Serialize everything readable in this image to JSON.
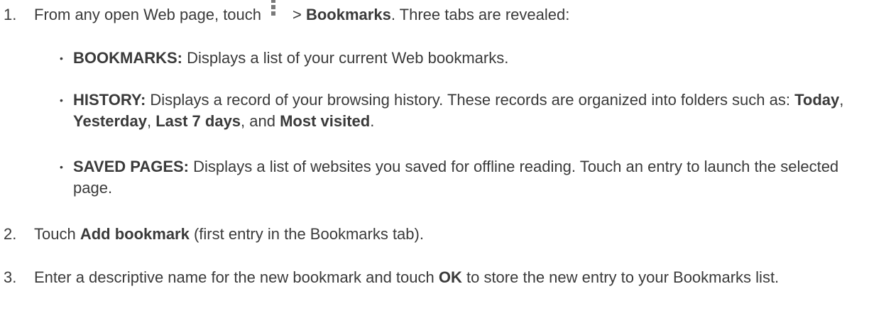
{
  "steps": [
    {
      "number": "1.",
      "before_icon": "From any open Web page, touch",
      "icon": "menu-overflow-icon",
      "after_icon_prefix": "> ",
      "bold": "Bookmarks",
      "after_bold": ". Three tabs are revealed:"
    },
    {
      "number": "2.",
      "prefix": "Touch ",
      "bold": "Add bookmark",
      "suffix": " (first entry in the Bookmarks tab)."
    },
    {
      "number": "3.",
      "prefix": "Enter a descriptive name for the new bookmark and touch ",
      "bold": "OK",
      "suffix": " to store the new entry to your Bookmarks list."
    }
  ],
  "bullets": [
    {
      "symbol": "•",
      "label": "BOOKMARKS:",
      "text": " Displays a list of your current Web bookmarks."
    },
    {
      "symbol": "•",
      "label": "HISTORY:",
      "text": " Displays a record of your browsing history. These records are organized into folders such as: ",
      "folders": [
        "Today",
        "Yesterday",
        "Last 7 days",
        "Most visited"
      ],
      "separators": [
        ", ",
        ", ",
        ", and "
      ],
      "end": "."
    },
    {
      "symbol": "•",
      "label": "SAVED PAGES:",
      "text": " Displays a list of websites you saved for offline reading. Touch an entry to launch the selected page."
    }
  ]
}
